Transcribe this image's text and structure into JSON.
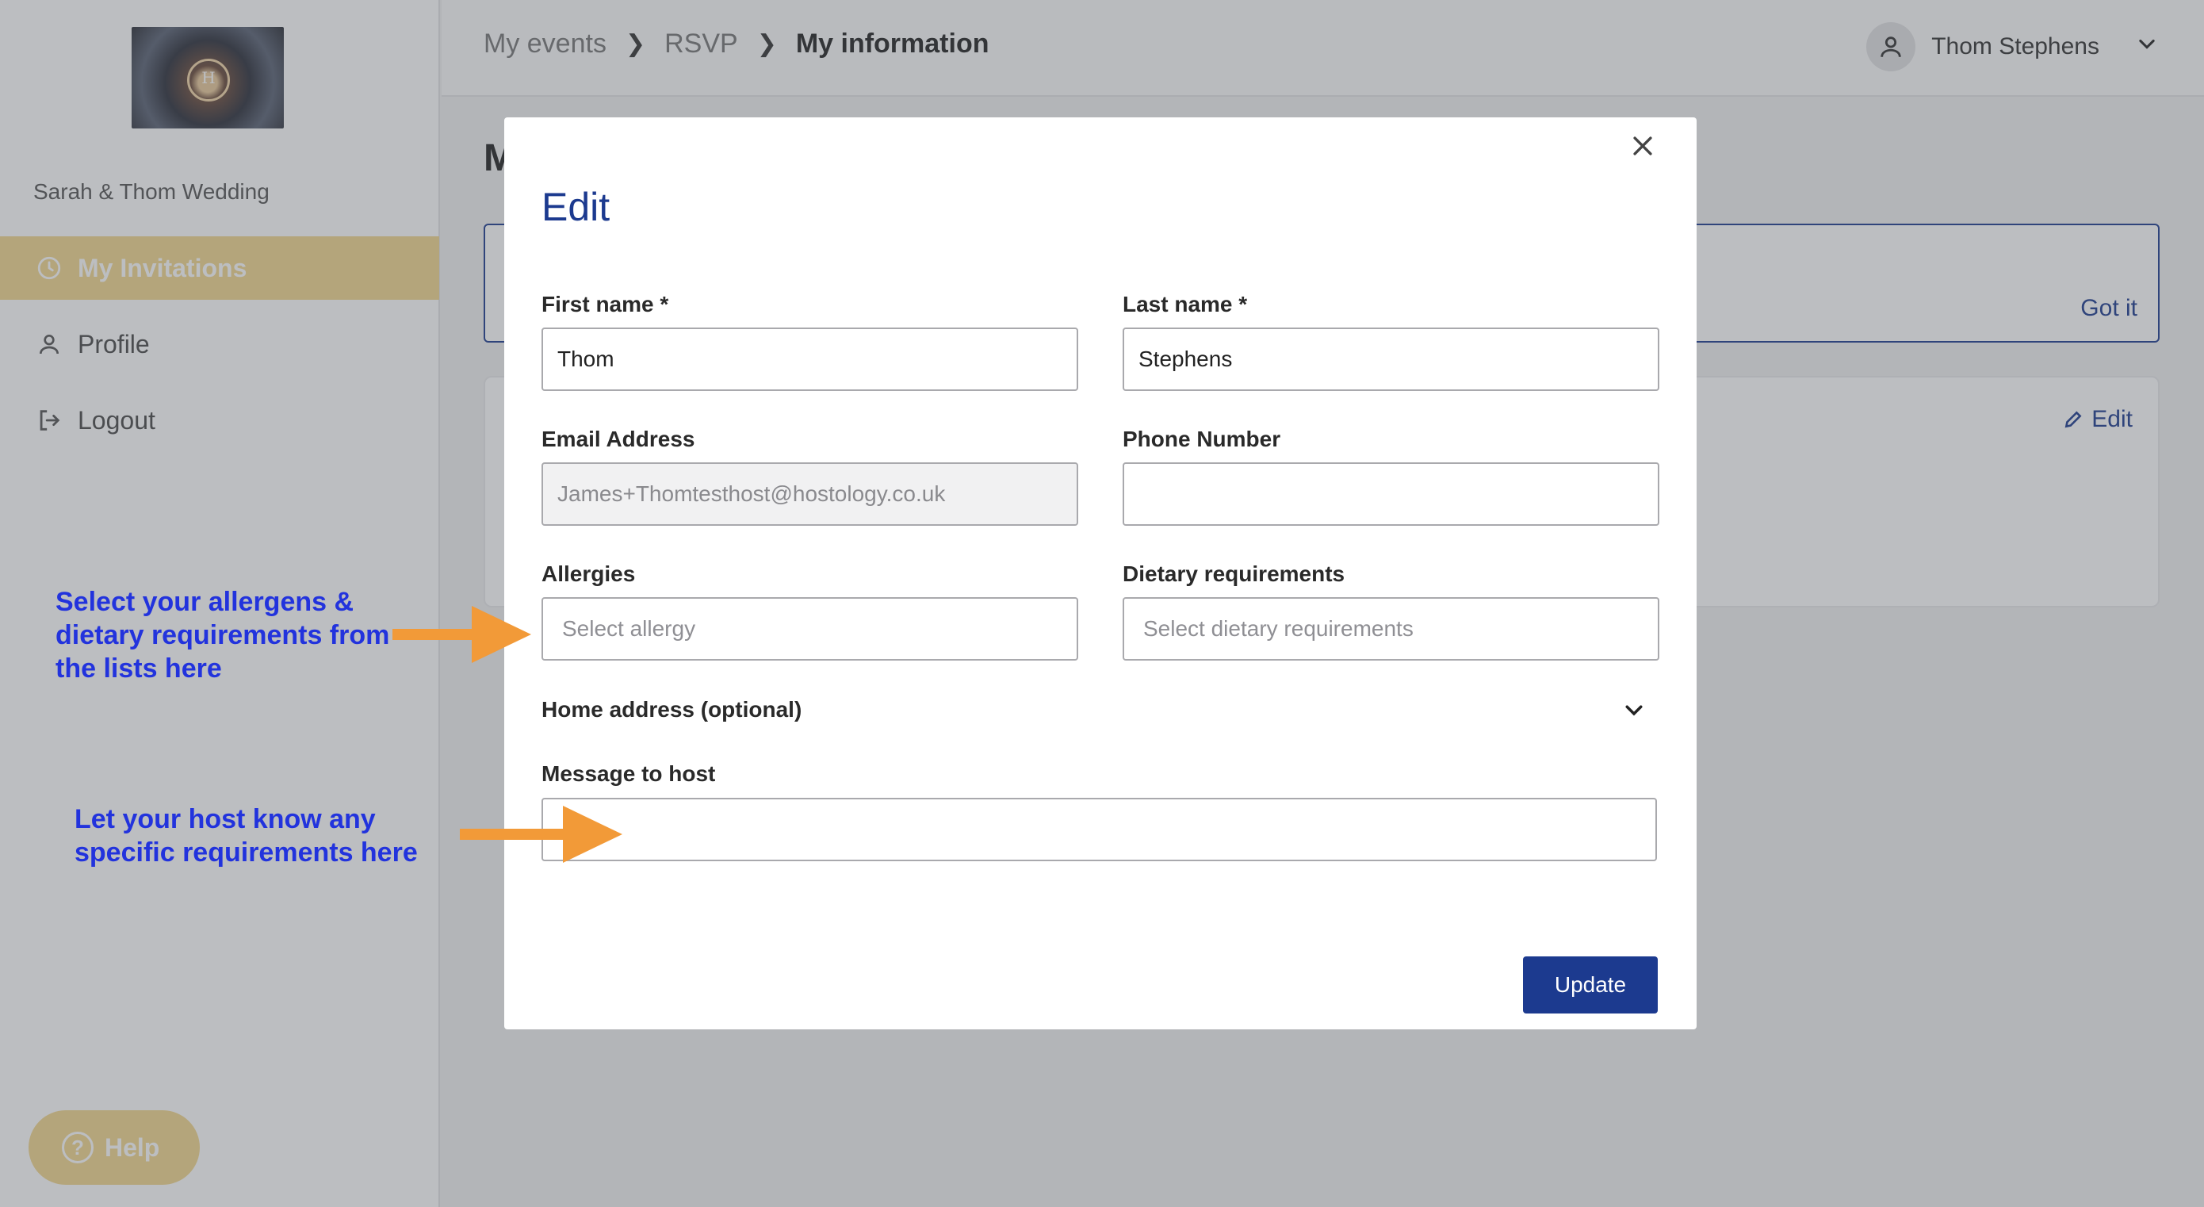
{
  "sidebar": {
    "event_name": "Sarah & Thom Wedding",
    "logo_monogram": "H",
    "items": [
      {
        "label": "My Invitations",
        "icon": "clock-icon",
        "active": true
      },
      {
        "label": "Profile",
        "icon": "person-icon",
        "active": false
      },
      {
        "label": "Logout",
        "icon": "logout-icon",
        "active": false
      }
    ],
    "help_label": "Help"
  },
  "header": {
    "breadcrumbs": [
      "My events",
      "RSVP",
      "My information"
    ],
    "user_name": "Thom Stephens"
  },
  "background_page": {
    "title_initial": "M",
    "banner_action": "Got it",
    "card_action": "Edit"
  },
  "modal": {
    "title": "Edit",
    "fields": {
      "first_name": {
        "label": "First name *",
        "value": "Thom"
      },
      "last_name": {
        "label": "Last name *",
        "value": "Stephens"
      },
      "email": {
        "label": "Email Address",
        "value": "James+Thomtesthost@hostology.co.uk"
      },
      "phone": {
        "label": "Phone Number",
        "value": ""
      },
      "allergies": {
        "label": "Allergies",
        "placeholder": "Select allergy"
      },
      "dietary": {
        "label": "Dietary requirements",
        "placeholder": "Select dietary requirements"
      },
      "message": {
        "label": "Message to host",
        "value": ""
      }
    },
    "address_toggle": "Home address (optional)",
    "update_label": "Update"
  },
  "annotations": {
    "allergens_line1": "Select your allergens &",
    "allergens_line2": "dietary requirements from",
    "allergens_line3": "the lists here",
    "host_line1": "Let your host know any",
    "host_line2": "specific requirements here",
    "color": "#2233dd",
    "arrow_color": "#f29a38"
  },
  "colors": {
    "brand_navy": "#1c3a8f",
    "sidebar_active": "#f3d78e"
  }
}
